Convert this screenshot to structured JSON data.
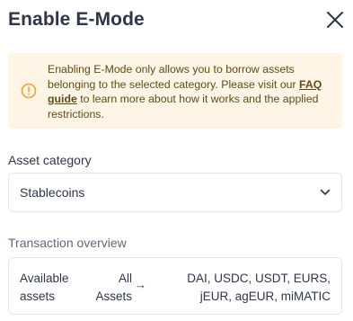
{
  "modal": {
    "title": "Enable E-Mode",
    "close_icon": "close-icon"
  },
  "warning": {
    "icon": "warning-circle-icon",
    "text_before": "Enabling E-Mode only allows you to borrow assets belonging to the selected category. Please visit our ",
    "link": "FAQ guide",
    "text_after": " to learn more about how it works and the applied restrictions."
  },
  "asset_category": {
    "label": "Asset category",
    "selected": "Stablecoins",
    "chevron_icon": "chevron-down-icon"
  },
  "transaction_overview": {
    "label": "Transaction overview",
    "row_label_line1": "Available",
    "row_label_line2": "assets",
    "from_line1": "All",
    "from_line2": "Assets",
    "arrow": "→",
    "to_line1": "DAI, USDC, USDT, EURS,",
    "to_line2": "jEUR, agEUR, miMATIC"
  },
  "colors": {
    "warning_bg": "#fef5e7",
    "warning_text": "#5f4b16",
    "warning_icon": "#f2a22b",
    "text_primary": "#303549",
    "border": "#e4e6ec"
  }
}
